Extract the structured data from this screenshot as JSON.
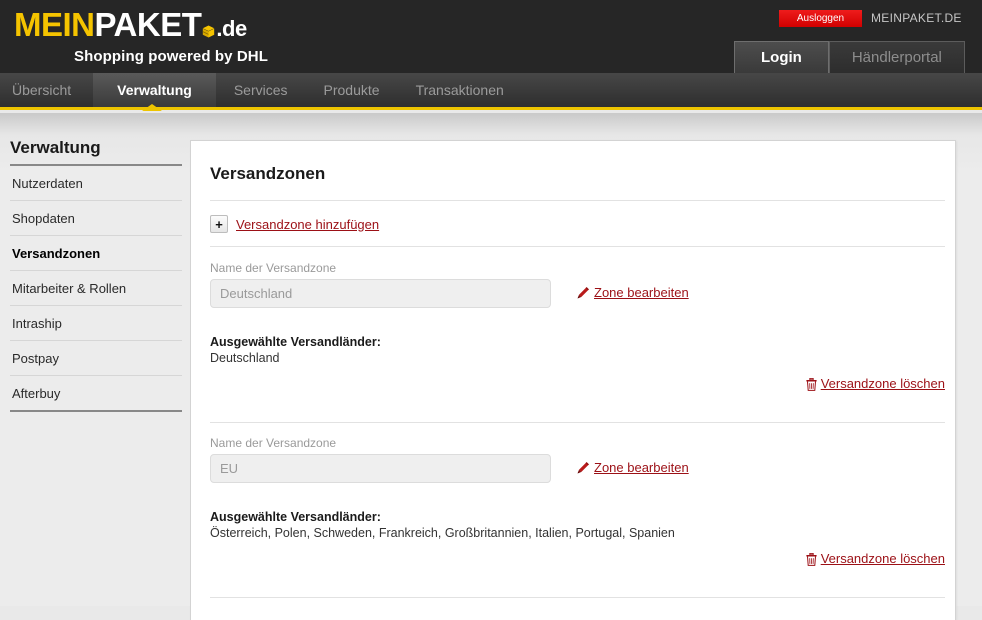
{
  "header": {
    "logo_mein": "MEIN",
    "logo_paket": "PAKET",
    "logo_de": ".de",
    "tagline": "Shopping powered by DHL",
    "logout_label": "Ausloggen",
    "portal_name": "MEINPAKET.DE",
    "tabs": [
      {
        "label": "Login",
        "active": true
      },
      {
        "label": "Händlerportal",
        "active": false
      }
    ],
    "accent_yellow": "#edc400",
    "accent_red": "#d10000"
  },
  "nav": {
    "items": [
      {
        "label": "Übersicht",
        "active": false
      },
      {
        "label": "Verwaltung",
        "active": true
      },
      {
        "label": "Services",
        "active": false
      },
      {
        "label": "Produkte",
        "active": false
      },
      {
        "label": "Transaktionen",
        "active": false
      }
    ]
  },
  "sidebar": {
    "title": "Verwaltung",
    "items": [
      {
        "label": "Nutzerdaten",
        "active": false
      },
      {
        "label": "Shopdaten",
        "active": false
      },
      {
        "label": "Versandzonen",
        "active": true
      },
      {
        "label": "Mitarbeiter & Rollen",
        "active": false
      },
      {
        "label": "Intraship",
        "active": false
      },
      {
        "label": "Postpay",
        "active": false
      },
      {
        "label": "Afterbuy",
        "active": false
      }
    ]
  },
  "main": {
    "title": "Versandzonen",
    "add_button_label": "+",
    "add_link_label": "Versandzone hinzufügen",
    "field_label": "Name der Versandzone",
    "edit_link_label": "Zone bearbeiten",
    "delete_link_label": "Versandzone löschen",
    "countries_heading": "Ausgewählte Versandländer:",
    "link_color": "#9c1016",
    "zones": [
      {
        "name_value": "Deutschland",
        "countries": "Deutschland"
      },
      {
        "name_value": "EU",
        "countries": "Österreich, Polen, Schweden, Frankreich, Großbritannien, Italien, Portugal, Spanien"
      }
    ]
  },
  "icons": {
    "plus": "plus-icon",
    "pencil": "pencil-icon",
    "trash": "trash-icon",
    "package": "package-box-icon"
  }
}
